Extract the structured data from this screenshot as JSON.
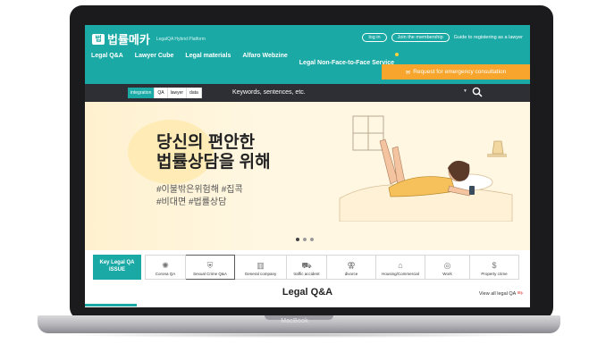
{
  "device": {
    "label": "MacBook"
  },
  "site": {
    "logo_mark": "법",
    "logo_text": "법률메카",
    "logo_sub": "LegalQA Hybrid Platform",
    "top_links": {
      "login": "log in",
      "join": "Join the membership",
      "guide": "Guide to registering as a lawyer"
    }
  },
  "nav": {
    "items": [
      "Legal Q&A",
      "Lawyer Cube",
      "Legal materials",
      "Alfaro Webzine",
      "Legal Non-Face-to-Face Service"
    ]
  },
  "emergency": {
    "label": "Request for emergency consultation"
  },
  "search": {
    "tabs": [
      "integration",
      "QA",
      "lawyer",
      "data"
    ],
    "active_tab": "integration",
    "placeholder": "Keywords, sentences, etc."
  },
  "hero": {
    "title_line1": "당신의 편안한",
    "title_line2": "법률상담을 위해",
    "tags_line1": "#이불밖은위험해 #집콕",
    "tags_line2": "#비대면 #법률상담",
    "carousel_count": 3,
    "carousel_active": 0
  },
  "issue": {
    "lead": "Key Legal QA ISSUE",
    "categories": [
      {
        "label": "Corona QA",
        "icon": "virus-icon"
      },
      {
        "label": "Sexual Crime Q&A",
        "icon": "shield-icon"
      },
      {
        "label": "General company",
        "icon": "building-icon"
      },
      {
        "label": "traffic accident",
        "icon": "car-icon"
      },
      {
        "label": "divorce",
        "icon": "divorce-icon"
      },
      {
        "label": "Housing/Commercial",
        "icon": "house-icon"
      },
      {
        "label": "Work",
        "icon": "briefcase-icon"
      },
      {
        "label": "Property crime",
        "icon": "money-icon"
      }
    ],
    "selected_index": 1
  },
  "qa_section": {
    "title": "Legal Q&A",
    "view_all": "View all legal QA"
  }
}
